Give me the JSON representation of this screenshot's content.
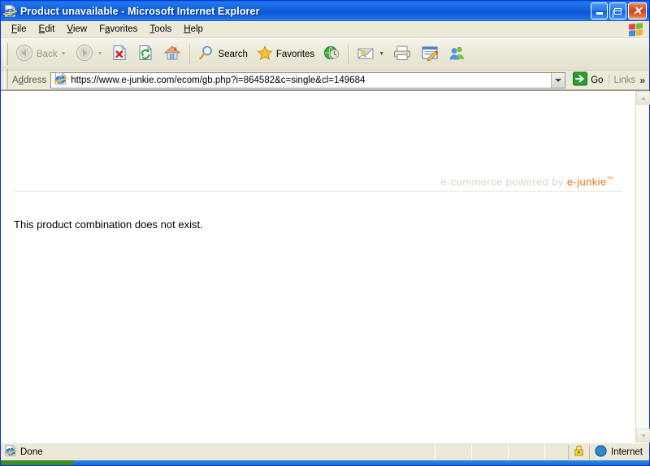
{
  "window": {
    "title": "Product unavailable - Microsoft Internet Explorer",
    "icon": "ie-document-icon",
    "controls": {
      "minimize": "Minimize",
      "restore": "Restore",
      "close": "Close"
    },
    "accent_title_blue": "#0f63e2",
    "chrome_face": "#ece9d8"
  },
  "menu": {
    "items": [
      {
        "label": "File",
        "accel": "F"
      },
      {
        "label": "Edit",
        "accel": "E"
      },
      {
        "label": "View",
        "accel": "V"
      },
      {
        "label": "Favorites",
        "accel": "a"
      },
      {
        "label": "Tools",
        "accel": "T"
      },
      {
        "label": "Help",
        "accel": "H"
      }
    ],
    "brand_icon": "windows-flag-icon"
  },
  "toolbar": {
    "back_label": "Back",
    "forward_label": "",
    "search_label": "Search",
    "favorites_label": "Favorites",
    "buttons": [
      {
        "name": "back-button",
        "label": "Back",
        "icon": "back-arrow-icon",
        "disabled": true
      },
      {
        "name": "forward-button",
        "label": "",
        "icon": "forward-arrow-icon",
        "disabled": true
      },
      {
        "name": "stop-button",
        "label": "",
        "icon": "stop-icon",
        "disabled": false
      },
      {
        "name": "refresh-button",
        "label": "",
        "icon": "refresh-icon",
        "disabled": false
      },
      {
        "name": "home-button",
        "label": "",
        "icon": "home-icon",
        "disabled": false
      },
      {
        "name": "search-button",
        "label": "Search",
        "icon": "search-icon",
        "disabled": false
      },
      {
        "name": "favorites-button",
        "label": "Favorites",
        "icon": "star-icon",
        "disabled": false
      },
      {
        "name": "media-button",
        "label": "",
        "icon": "media-globe-icon",
        "disabled": false
      },
      {
        "name": "mail-button",
        "label": "",
        "icon": "mail-icon",
        "disabled": false
      },
      {
        "name": "print-button",
        "label": "",
        "icon": "printer-icon",
        "disabled": false
      },
      {
        "name": "edit-button",
        "label": "",
        "icon": "edit-page-icon",
        "disabled": false
      },
      {
        "name": "messenger-button",
        "label": "",
        "icon": "messenger-people-icon",
        "disabled": false
      }
    ]
  },
  "address": {
    "label": "Address",
    "url": "https://www.e-junkie.com/ecom/gb.php?i=864582&c=single&cl=149684",
    "placeholder": "",
    "site_icon": "ie-page-icon",
    "dropdown_icon": "chevron-down-icon",
    "go_label": "Go",
    "go_icon": "go-arrow-icon",
    "links_label": "Links",
    "links_overflow": "»"
  },
  "page": {
    "branding_prefix": "e-commerce powered by",
    "branding_name": "e-junkie",
    "branding_tm": "™",
    "branding_color": "#ea7320",
    "branding_prefix_color": "#d9d4cc",
    "message": "This product combination does not exist."
  },
  "scrollbar": {
    "up_icon": "scroll-up-arrow-icon",
    "down_icon": "scroll-down-arrow-icon"
  },
  "statusbar": {
    "status_text": "Done",
    "status_icon": "ie-page-icon",
    "security_icon": "padlock-icon",
    "zone_icon": "globe-icon",
    "zone_label": "Internet"
  }
}
